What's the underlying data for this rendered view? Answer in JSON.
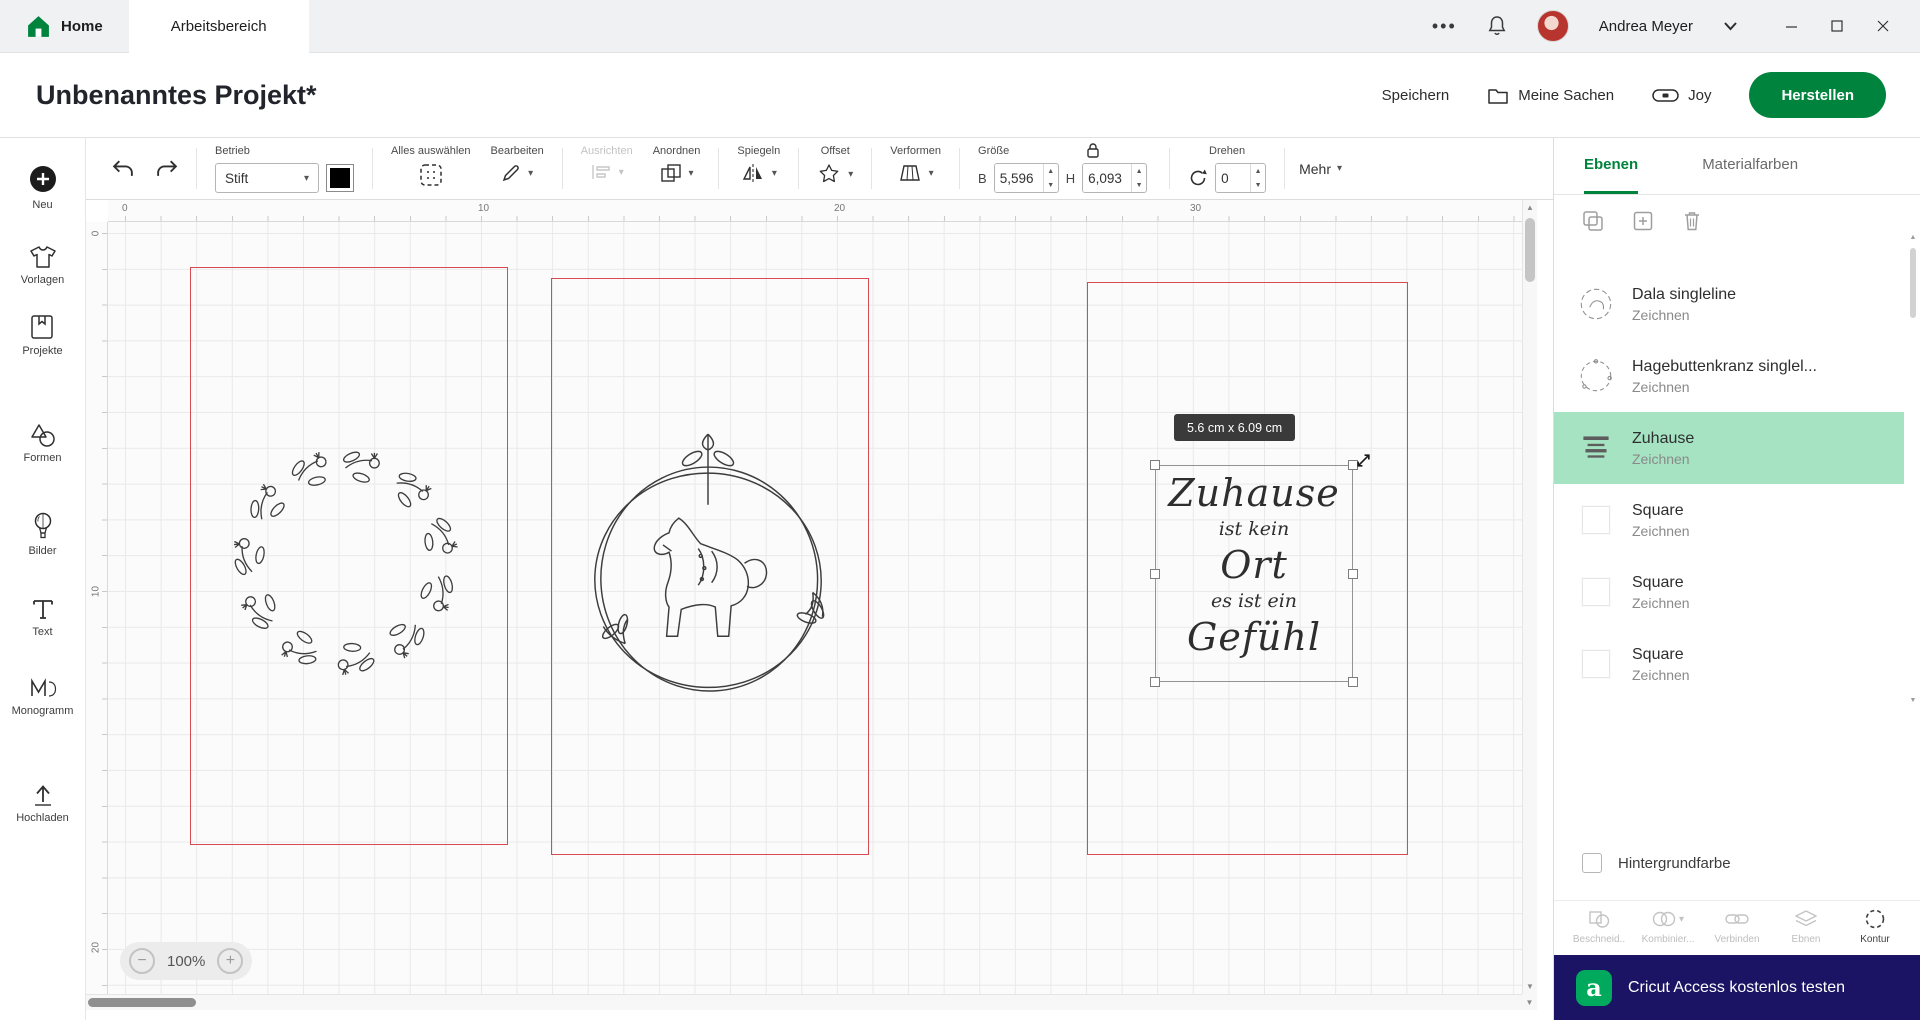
{
  "topbar": {
    "home": "Home",
    "workspace_tab": "Arbeitsbereich",
    "user_name": "Andrea Meyer"
  },
  "header": {
    "project_title": "Unbenanntes Projekt*",
    "save": "Speichern",
    "my_stuff": "Meine Sachen",
    "machine": "Joy",
    "make": "Herstellen"
  },
  "sidebar": {
    "items": [
      {
        "label": "Neu"
      },
      {
        "label": "Vorlagen"
      },
      {
        "label": "Projekte"
      },
      {
        "label": "Formen"
      },
      {
        "label": "Bilder"
      },
      {
        "label": "Text"
      },
      {
        "label": "Monogramm"
      },
      {
        "label": "Hochladen"
      }
    ]
  },
  "toolbar": {
    "operation_label": "Betrieb",
    "operation_value": "Stift",
    "select_all": "Alles auswählen",
    "edit": "Bearbeiten",
    "align": "Ausrichten",
    "arrange": "Anordnen",
    "flip": "Spiegeln",
    "offset": "Offset",
    "deform": "Verformen",
    "size_label": "Größe",
    "width_prefix": "B",
    "width_value": "5,596",
    "height_prefix": "H",
    "height_value": "6,093",
    "rotate_label": "Drehen",
    "rotate_value": "0",
    "more": "Mehr"
  },
  "canvas": {
    "h_ruler": [
      "0",
      "10",
      "20",
      "30"
    ],
    "v_ruler": [
      "0",
      "10",
      "20"
    ],
    "zoom": "100%",
    "selection_tooltip": "5.6  cm x 6.09  cm",
    "text_lines": [
      "Zuhause",
      "ist kein",
      "Ort",
      "es ist ein",
      "Gefühl"
    ]
  },
  "panel": {
    "tab_layers": "Ebenen",
    "tab_materials": "Materialfarben",
    "layers": [
      {
        "name": "Dala singleline",
        "type": "Zeichnen"
      },
      {
        "name": "Hagebuttenkranz singlel...",
        "type": "Zeichnen"
      },
      {
        "name": "Zuhause",
        "type": "Zeichnen"
      },
      {
        "name": "Square",
        "type": "Zeichnen"
      },
      {
        "name": "Square",
        "type": "Zeichnen"
      },
      {
        "name": "Square",
        "type": "Zeichnen"
      }
    ],
    "background_label": "Hintergrundfarbe",
    "actions": [
      {
        "label": "Beschneid.."
      },
      {
        "label": "Kombinier..."
      },
      {
        "label": "Verbinden"
      },
      {
        "label": "Ebnen"
      },
      {
        "label": "Kontur"
      }
    ],
    "banner": "Cricut Access kostenlos testen"
  },
  "colors": {
    "brand_green": "#00843d",
    "selected_layer_bg": "#a5e3c3",
    "card_outline_red": "#d84a52",
    "banner_bg": "#1b1464",
    "banner_logo_green": "#00a95c",
    "operation_swatch": "#000000"
  }
}
